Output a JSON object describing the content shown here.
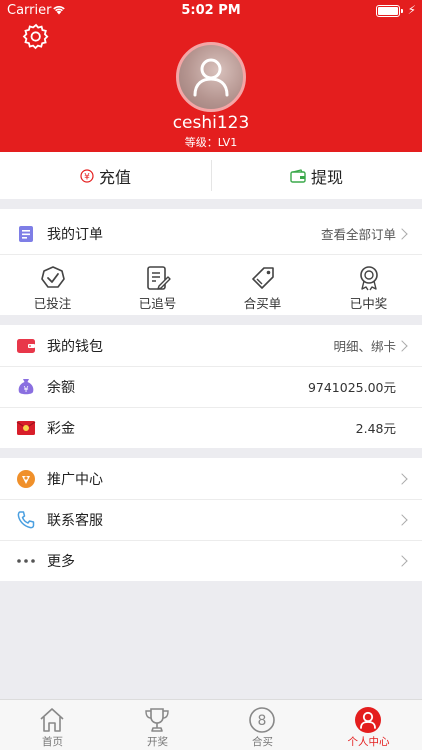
{
  "status_bar": {
    "carrier": "Carrier",
    "time": "5:02 PM"
  },
  "profile": {
    "username": "ceshi123",
    "level": "等级：LV1"
  },
  "actions": {
    "recharge": "充值",
    "withdraw": "提现",
    "recharge_glyph": "¥"
  },
  "orders": {
    "title": "我的订单",
    "view_all": "查看全部订单",
    "items": [
      {
        "label": "已投注",
        "icon": "check-badge-icon"
      },
      {
        "label": "已追号",
        "icon": "edit-note-icon"
      },
      {
        "label": "合买单",
        "icon": "tag-icon"
      },
      {
        "label": "已中奖",
        "icon": "award-medal-icon"
      }
    ]
  },
  "wallet": {
    "title": "我的钱包",
    "detail": "明细、绑卡",
    "balance_label": "余额",
    "balance_value": "9741025.00元",
    "bonus_label": "彩金",
    "bonus_value": "2.48元"
  },
  "menu": {
    "promotion": "推广中心",
    "service": "联系客服",
    "more": "更多"
  },
  "tabs": [
    {
      "label": "首页",
      "icon": "home-icon"
    },
    {
      "label": "开奖",
      "icon": "trophy-icon"
    },
    {
      "label": "合买",
      "icon": "number-8-icon"
    },
    {
      "label": "个人中心",
      "icon": "person-icon"
    }
  ],
  "colors": {
    "brand_red": "#e41e1e",
    "withdraw_green": "#3aa84a",
    "order_icon_purple": "#7e7ee6",
    "wallet_red": "#e8374a",
    "balance_purple": "#8a6fe0",
    "promo_orange": "#f0902a",
    "service_blue": "#4a9fe0"
  }
}
